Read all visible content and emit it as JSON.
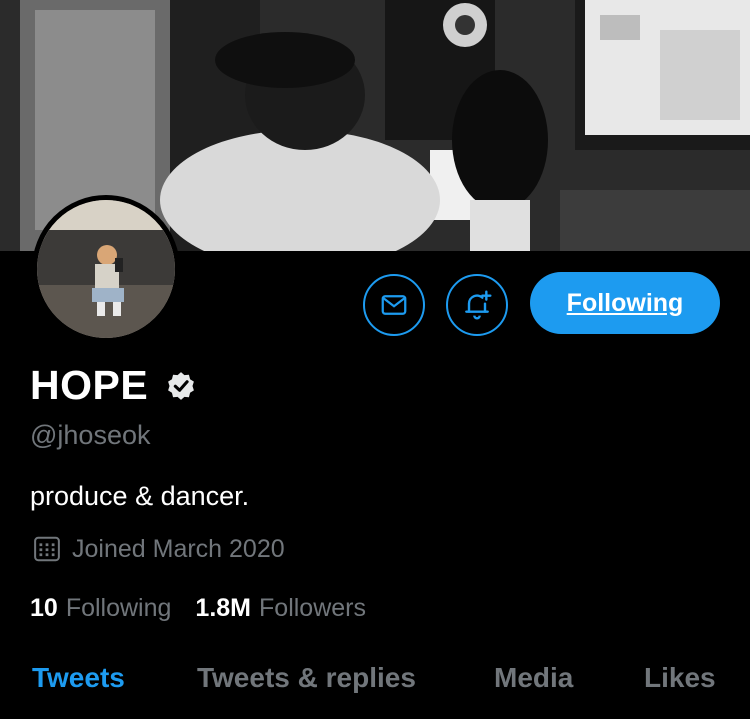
{
  "profile": {
    "display_name": "HOPE",
    "handle": "@jhoseok",
    "bio": "produce & dancer.",
    "joined": "Joined March 2020",
    "verified": true
  },
  "stats": {
    "following_count": "10",
    "following_label": "Following",
    "followers_count": "1.8M",
    "followers_label": "Followers"
  },
  "actions": {
    "follow_label": "Following",
    "message_icon": "envelope-icon",
    "notify_icon": "bell-plus-icon"
  },
  "tabs": [
    {
      "label": "Tweets",
      "active": true
    },
    {
      "label": "Tweets & replies",
      "active": false
    },
    {
      "label": "Media",
      "active": false
    },
    {
      "label": "Likes",
      "active": false
    }
  ],
  "colors": {
    "accent": "#1d9bf0",
    "background": "#000000",
    "muted_text": "#71767b",
    "primary_text": "#ffffff"
  }
}
